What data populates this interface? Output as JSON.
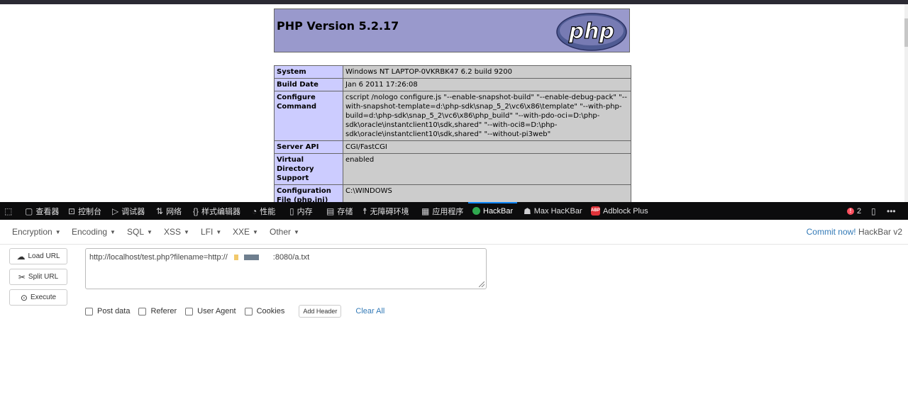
{
  "phpinfo": {
    "title": "PHP Version 5.2.17",
    "logo_text": "php",
    "rows": [
      {
        "key": "System",
        "value": "Windows NT LAPTOP-0VKRBK47 6.2 build 9200"
      },
      {
        "key": "Build Date",
        "value": "Jan 6 2011 17:26:08"
      },
      {
        "key": "Configure Command",
        "value": "cscript /nologo configure.js \"--enable-snapshot-build\" \"--enable-debug-pack\" \"--with-snapshot-template=d:\\php-sdk\\snap_5_2\\vc6\\x86\\template\" \"--with-php-build=d:\\php-sdk\\snap_5_2\\vc6\\x86\\php_build\" \"--with-pdo-oci=D:\\php-sdk\\oracle\\instantclient10\\sdk,shared\" \"--with-oci8=D:\\php-sdk\\oracle\\instantclient10\\sdk,shared\" \"--without-pi3web\""
      },
      {
        "key": "Server API",
        "value": "CGI/FastCGI"
      },
      {
        "key": "Virtual Directory Support",
        "value": "enabled"
      },
      {
        "key": "Configuration File (php.ini) Path",
        "value": "C:\\WINDOWS"
      }
    ]
  },
  "devtools": {
    "tabs": [
      {
        "label": "查看器",
        "icon": "inspector-icon"
      },
      {
        "label": "控制台",
        "icon": "console-icon"
      },
      {
        "label": "调试器",
        "icon": "debugger-icon"
      },
      {
        "label": "网络",
        "icon": "network-icon"
      },
      {
        "label": "样式编辑器",
        "icon": "style-editor-icon"
      },
      {
        "label": "性能",
        "icon": "performance-icon"
      },
      {
        "label": "内存",
        "icon": "memory-icon"
      },
      {
        "label": "存储",
        "icon": "storage-icon"
      },
      {
        "label": "无障碍环境",
        "icon": "accessibility-icon"
      },
      {
        "label": "应用程序",
        "icon": "application-icon"
      },
      {
        "label": "HackBar",
        "icon": "hackbar-icon",
        "active": true
      },
      {
        "label": "Max HacKBar",
        "icon": "max-hackbar-icon"
      },
      {
        "label": "Adblock Plus",
        "icon": "adblock-icon"
      }
    ],
    "error_count": "2",
    "accent_color": "#0a84ff"
  },
  "hackbar": {
    "menus": [
      "Encryption",
      "Encoding",
      "SQL",
      "XSS",
      "LFI",
      "XXE",
      "Other"
    ],
    "commit_link": "Commit now!",
    "version": "HackBar v2",
    "buttons": {
      "load": "Load URL",
      "split": "Split URL",
      "execute": "Execute"
    },
    "url_prefix": "http://localhost/test.php?filename=http://",
    "url_suffix": ":8080/a.txt",
    "options": [
      "Post data",
      "Referer",
      "User Agent",
      "Cookies"
    ],
    "add_header": "Add Header",
    "clear_all": "Clear All"
  }
}
